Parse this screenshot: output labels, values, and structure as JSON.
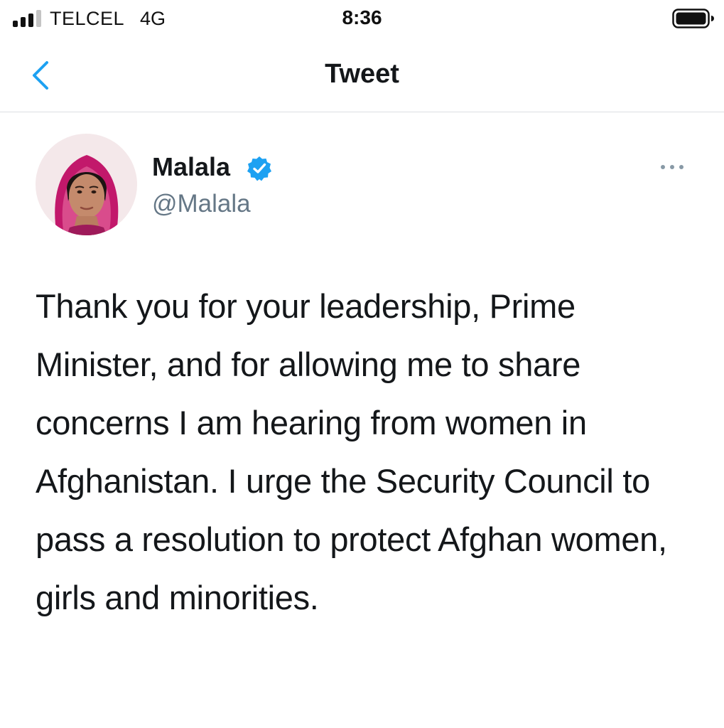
{
  "status_bar": {
    "carrier": "TELCEL",
    "network": "4G",
    "time": "8:36",
    "signal_icon": "signal-bars-icon",
    "battery_icon": "battery-icon"
  },
  "nav": {
    "back_icon": "chevron-left-icon",
    "title": "Tweet"
  },
  "tweet": {
    "author_name": "Malala",
    "verified_icon": "verified-badge-icon",
    "handle": "@Malala",
    "more_icon": "more-horizontal-icon",
    "text": "Thank you for your leadership, Prime Minister, and for allowing me to share concerns I am hearing from women in Afghanistan. I urge the Security Council to pass a resolution to protect Afghan women, girls and minorities."
  },
  "colors": {
    "accent": "#1da1f2",
    "text_primary": "#14171a",
    "text_secondary": "#657786",
    "divider": "#dcdfe2"
  }
}
